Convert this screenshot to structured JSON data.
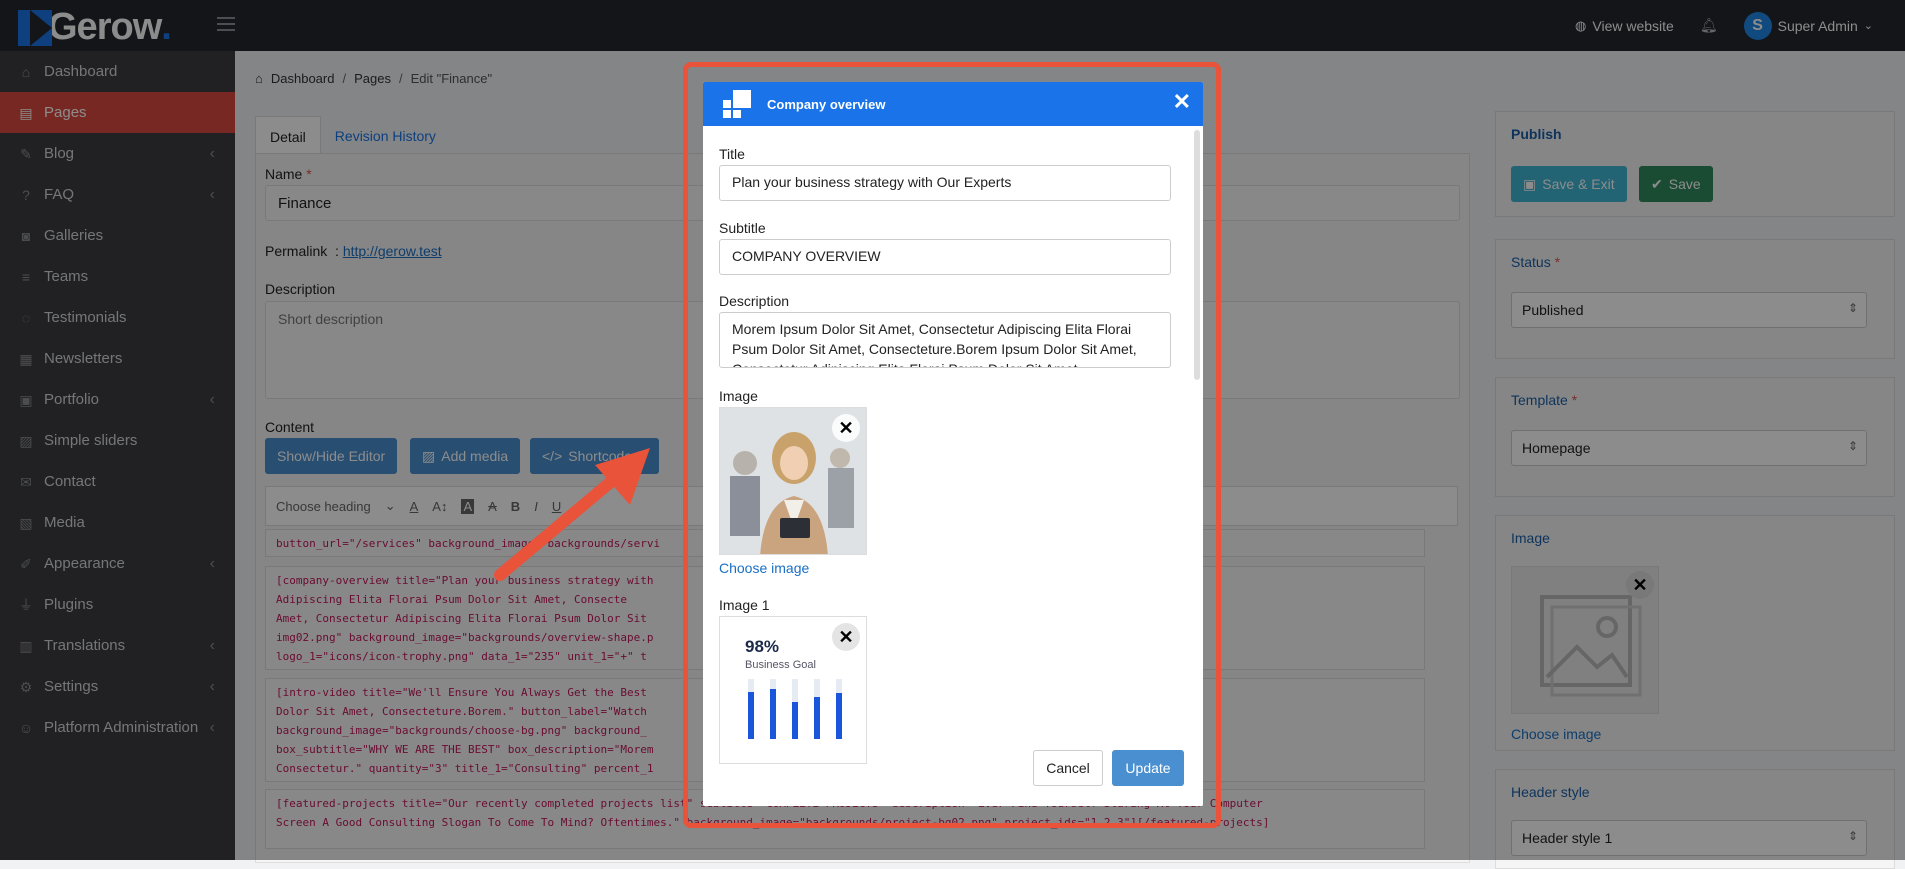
{
  "topbar": {
    "logo_text": "Gerow",
    "logo_dot": ".",
    "view_website": "View website",
    "user_initial": "S",
    "user_name": "Super Admin"
  },
  "sidebar": {
    "items": [
      {
        "label": "Dashboard",
        "icon": "home-icon",
        "glyph": "⌂"
      },
      {
        "label": "Pages",
        "icon": "page-icon",
        "glyph": "▤"
      },
      {
        "label": "Blog",
        "icon": "edit-icon",
        "glyph": "✎"
      },
      {
        "label": "FAQ",
        "icon": "question-icon",
        "glyph": "?"
      },
      {
        "label": "Galleries",
        "icon": "camera-icon",
        "glyph": "◙"
      },
      {
        "label": "Teams",
        "icon": "list-icon",
        "glyph": "≡"
      },
      {
        "label": "Testimonials",
        "icon": "comment-icon",
        "glyph": "◌"
      },
      {
        "label": "Newsletters",
        "icon": "newsletter-icon",
        "glyph": "▦"
      },
      {
        "label": "Portfolio",
        "icon": "briefcase-icon",
        "glyph": "▣"
      },
      {
        "label": "Simple sliders",
        "icon": "image-icon",
        "glyph": "▨"
      },
      {
        "label": "Contact",
        "icon": "mail-icon",
        "glyph": "✉"
      },
      {
        "label": "Media",
        "icon": "media-icon",
        "glyph": "▧"
      },
      {
        "label": "Appearance",
        "icon": "brush-icon",
        "glyph": "✐"
      },
      {
        "label": "Plugins",
        "icon": "plug-icon",
        "glyph": "⏚"
      },
      {
        "label": "Translations",
        "icon": "language-icon",
        "glyph": "▥"
      },
      {
        "label": "Settings",
        "icon": "cogs-icon",
        "glyph": "⚙"
      },
      {
        "label": "Platform Administration",
        "icon": "user-cog-icon",
        "glyph": "☺"
      }
    ]
  },
  "breadcrumb": {
    "home": "Dashboard",
    "pages": "Pages",
    "current": "Edit \"Finance\""
  },
  "tabs": {
    "detail": "Detail",
    "revision": "Revision History"
  },
  "form": {
    "name_label": "Name",
    "name_value": "Finance",
    "permalink_label": "Permalink",
    "permalink_url": "http://gerow.test",
    "description_label": "Description",
    "description_placeholder": "Short description",
    "content_label": "Content",
    "show_hide_editor": "Show/Hide Editor",
    "add_media": "Add media",
    "shortcode": "Shortcode",
    "choose_heading": "Choose heading"
  },
  "code_blocks": [
    "button_url=\"/services\" background_image=\"backgrounds/servi",
    "[company-overview title=\"Plan your business strategy with                                            Dolor Sit Amet, Consectetur\nAdipiscing Elita Florai Psum Dolor Sit Amet, Consecte                                                  m. Morem Ipsum Dolor Sit\nAmet, Consectetur Adipiscing Elita Florai Psum Dolor Sit                                              _1=\"general/overview-\nimg02.png\" background_image=\"backgrounds/overview-shape.p                                              y=\"2\" title_1=\"Best Award\"\nlogo_1=\"icons/icon-trophy.png\" data_1=\"235\" unit_1=\"+\" t                                              it_2=\"K\"][/company-overview]",
    "[intro-video title=\"We'll Ensure You Always Get the Best                                               dipiscing Elita Florai Psum\nDolor Sit Amet, Consecteture.Borem.\" button_label=\"Watch                                              s\"\nbackground_image=\"backgrounds/choose-bg.png\" background_                                              nce For you Solutions\"\nbox_subtitle=\"WHY WE ARE THE BEST\" box_description=\"Morem                                             Aonsectet Borem Ipsum\nConsectetur.\" quantity=\"3\" title_1=\"Consulting\" percent_1                                              t_3=\"90\"][/intro-video]",
    "[featured-projects title=\"Our recently completed projects list\" subtitle=\"COMPLETE PROJECTS\" description=\"Ever Find Yourself Staring At Your Computer\nScreen A Good Consulting Slogan To Come To Mind? Oftentimes.\" background_image=\"backgrounds/project-bg02.png\" project_ids=\"1,2,3\"][/featured-projects]"
  ],
  "right": {
    "publish_title": "Publish",
    "save_exit": "Save & Exit",
    "save": "Save",
    "status_label": "Status",
    "status_value": "Published",
    "template_label": "Template",
    "template_value": "Homepage",
    "image_label": "Image",
    "choose_image": "Choose image",
    "header_style_label": "Header style",
    "header_style_value": "Header style 1"
  },
  "modal": {
    "title": "Company overview",
    "title_label": "Title",
    "title_value": "Plan your business strategy with Our Experts",
    "subtitle_label": "Subtitle",
    "subtitle_value": "COMPANY OVERVIEW",
    "description_label": "Description",
    "description_value": "Morem Ipsum Dolor Sit Amet, Consectetur Adipiscing Elita Florai Psum Dolor Sit Amet, Consecteture.Borem Ipsum Dolor Sit Amet, Consectetur Adipiscing Elita Florai Psum Dolor Sit Amet.",
    "image_label": "Image",
    "choose_image": "Choose image",
    "image1_label": "Image 1",
    "stat_value": "98%",
    "stat_caption": "Business Goal",
    "cancel": "Cancel",
    "update": "Update"
  },
  "colors": {
    "accent": "#1a73e8",
    "sidebar_active": "#d94a40",
    "highlight": "#e8533a",
    "cyan": "#3fb5d4",
    "green": "#2f8a5e"
  }
}
